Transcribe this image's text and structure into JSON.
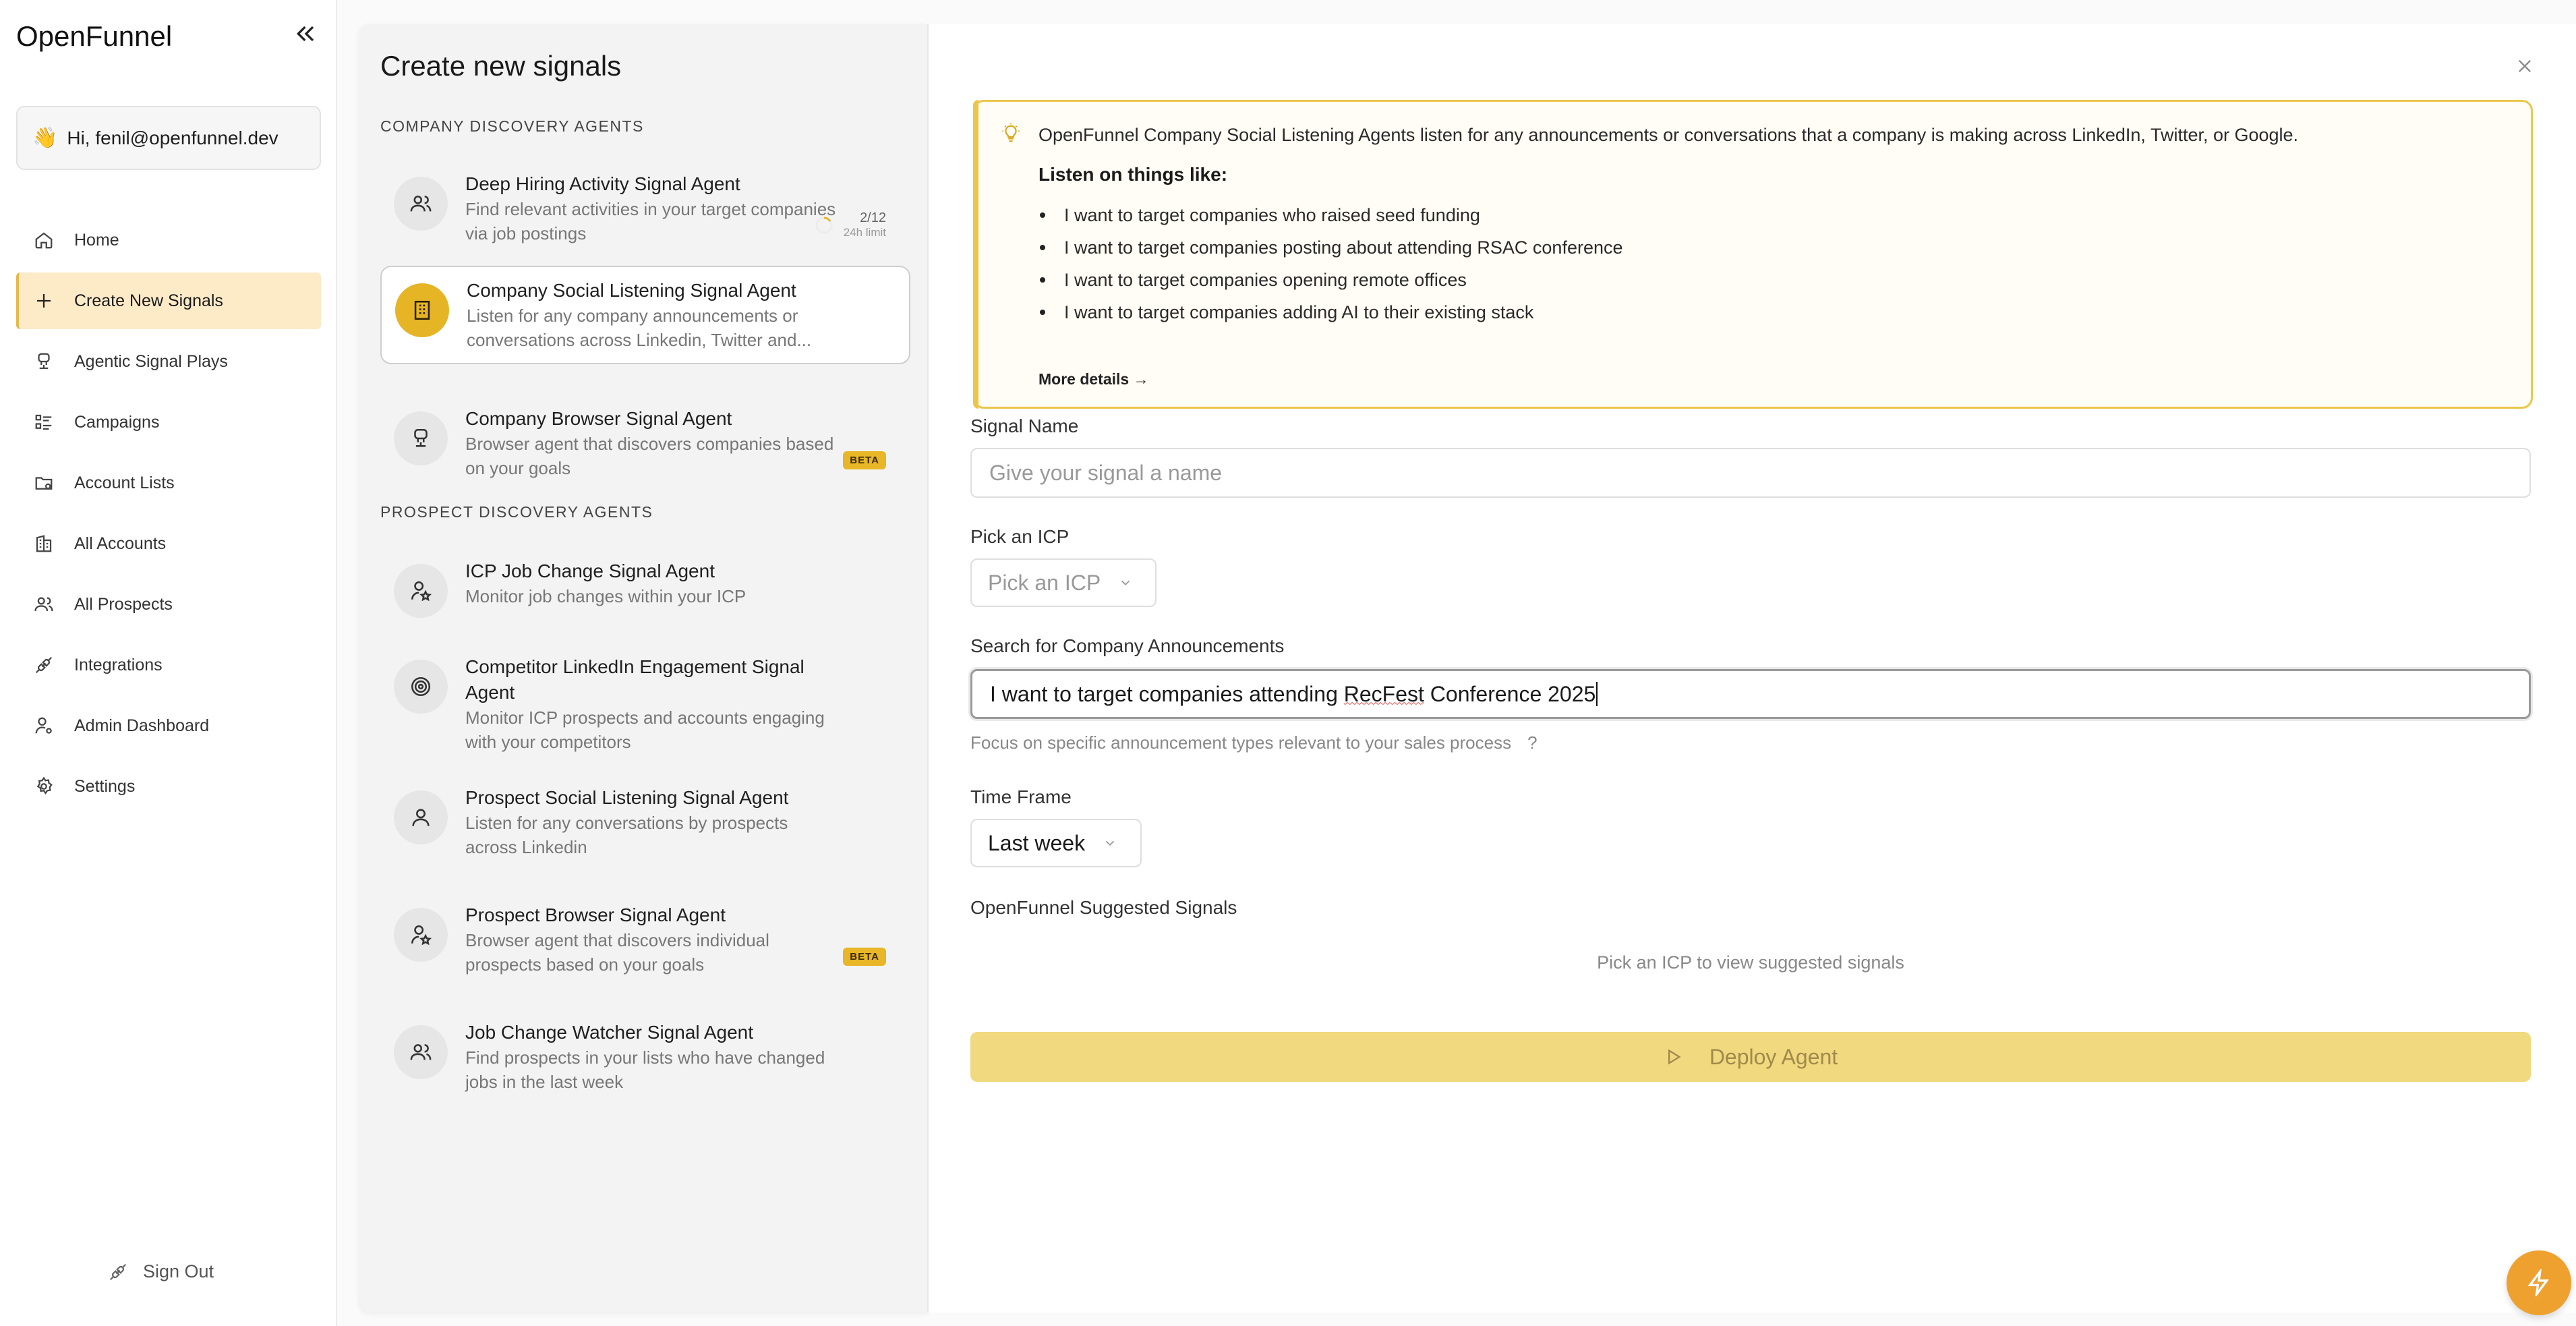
{
  "brand": "OpenFunnel",
  "greeting": "Hi, fenil@openfunnel.dev",
  "nav": [
    {
      "label": "Home",
      "icon": "home-icon"
    },
    {
      "label": "Create New Signals",
      "icon": "plus-icon",
      "active": true
    },
    {
      "label": "Agentic Signal Plays",
      "icon": "robot-icon"
    },
    {
      "label": "Campaigns",
      "icon": "list-check-icon"
    },
    {
      "label": "Account Lists",
      "icon": "folder-icon"
    },
    {
      "label": "All Accounts",
      "icon": "building-icon"
    },
    {
      "label": "All Prospects",
      "icon": "users-icon"
    },
    {
      "label": "Integrations",
      "icon": "plug-icon"
    },
    {
      "label": "Admin Dashboard",
      "icon": "user-gear-icon"
    },
    {
      "label": "Settings",
      "icon": "gear-icon"
    }
  ],
  "signout": "Sign Out",
  "middle": {
    "title": "Create new signals",
    "company_section": "COMPANY DISCOVERY AGENTS",
    "prospect_section": "PROSPECT DISCOVERY AGENTS",
    "agents": [
      {
        "name": "Deep Hiring Activity Signal Agent",
        "desc": "Find relevant activities in your target companies via job postings",
        "limit_count": "2/12",
        "limit_label": "24h limit"
      },
      {
        "name": "Company Social Listening Signal Agent",
        "desc": "Listen for any company announcements or conversations across Linkedin, Twitter and...",
        "selected": true
      },
      {
        "name": "Company Browser Signal Agent",
        "desc": "Browser agent that discovers companies based on your goals",
        "badge": "BETA"
      },
      {
        "name": "ICP Job Change Signal Agent",
        "desc": "Monitor job changes within your ICP"
      },
      {
        "name": "Competitor LinkedIn Engagement Signal Agent",
        "desc": "Monitor ICP prospects and accounts engaging with your competitors"
      },
      {
        "name": "Prospect Social Listening Signal Agent",
        "desc": "Listen for any conversations by prospects across Linkedin"
      },
      {
        "name": "Prospect Browser Signal Agent",
        "desc": "Browser agent that discovers individual prospects based on your goals",
        "badge": "BETA"
      },
      {
        "name": "Job Change Watcher Signal Agent",
        "desc": "Find prospects in your lists who have changed jobs in the last week"
      }
    ]
  },
  "info": {
    "intro": "OpenFunnel Company Social Listening Agents listen for any announcements or conversations that a company is making across LinkedIn, Twitter, or Google.",
    "listen_title": "Listen on things like:",
    "examples": [
      "I want to target companies who raised seed funding",
      "I want to target companies posting about attending RSAC conference",
      "I want to target companies opening remote offices",
      "I want to target companies adding AI to their existing stack"
    ],
    "more": "More details →"
  },
  "form": {
    "signal_name_label": "Signal Name",
    "signal_name_placeholder": "Give your signal a name",
    "icp_label": "Pick an ICP",
    "icp_value": "Pick an ICP",
    "search_label": "Search for Company Announcements",
    "search_value_a": "I want to target companies attending ",
    "search_value_b": "RecFest",
    "search_value_c": " Conference 2025",
    "search_hint": "Focus on specific announcement types relevant to your sales process",
    "search_hint_q": "?",
    "timeframe_label": "Time Frame",
    "timeframe_value": "Last week",
    "suggested_label": "OpenFunnel Suggested Signals",
    "suggested_empty": "Pick an ICP to view suggested signals",
    "deploy_label": "Deploy Agent"
  },
  "colors": {
    "accent": "#e6b526",
    "active_nav_bg": "#fdebc8",
    "fab": "#eea12f",
    "deploy_bg": "#f1d980"
  }
}
